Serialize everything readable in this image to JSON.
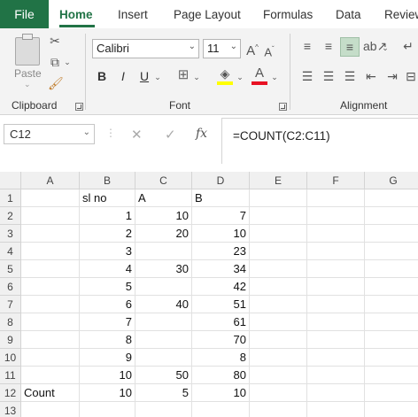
{
  "tabs": {
    "file": "File",
    "items": [
      "Home",
      "Insert",
      "Page Layout",
      "Formulas",
      "Data",
      "Review"
    ],
    "active": "Home"
  },
  "ribbon": {
    "clipboard": {
      "label": "Clipboard",
      "paste_label": "Paste"
    },
    "font": {
      "label": "Font",
      "font_name": "Calibri",
      "font_size": "11",
      "bold": "B",
      "italic": "I",
      "underline": "U"
    },
    "alignment": {
      "label": "Alignment"
    }
  },
  "formula_bar": {
    "name_box": "C12",
    "cancel_icon": "✕",
    "enter_icon": "✓",
    "fx_label": "fx",
    "formula": "=COUNT(C2:C11)"
  },
  "grid": {
    "columns": [
      "A",
      "B",
      "C",
      "D",
      "E",
      "F",
      "G"
    ],
    "rows": [
      {
        "n": "1",
        "A": "",
        "B": "sl no",
        "C": "A",
        "D": "B"
      },
      {
        "n": "2",
        "A": "",
        "B": "1",
        "C": "10",
        "D": "7"
      },
      {
        "n": "3",
        "A": "",
        "B": "2",
        "C": "20",
        "D": "10"
      },
      {
        "n": "4",
        "A": "",
        "B": "3",
        "C": "",
        "D": "23"
      },
      {
        "n": "5",
        "A": "",
        "B": "4",
        "C": "30",
        "D": "34"
      },
      {
        "n": "6",
        "A": "",
        "B": "5",
        "C": "",
        "D": "42"
      },
      {
        "n": "7",
        "A": "",
        "B": "6",
        "C": "40",
        "D": "51"
      },
      {
        "n": "8",
        "A": "",
        "B": "7",
        "C": "",
        "D": "61"
      },
      {
        "n": "9",
        "A": "",
        "B": "8",
        "C": "",
        "D": "70"
      },
      {
        "n": "10",
        "A": "",
        "B": "9",
        "C": "",
        "D": "8"
      },
      {
        "n": "11",
        "A": "",
        "B": "10",
        "C": "50",
        "D": "80"
      },
      {
        "n": "12",
        "A": "Count",
        "B": "10",
        "C": "5",
        "D": "10"
      },
      {
        "n": "13",
        "A": "",
        "B": "",
        "C": "",
        "D": ""
      }
    ]
  },
  "colors": {
    "accent": "#217346",
    "fill_highlight": "#ffff00",
    "font_color": "#e81123"
  }
}
